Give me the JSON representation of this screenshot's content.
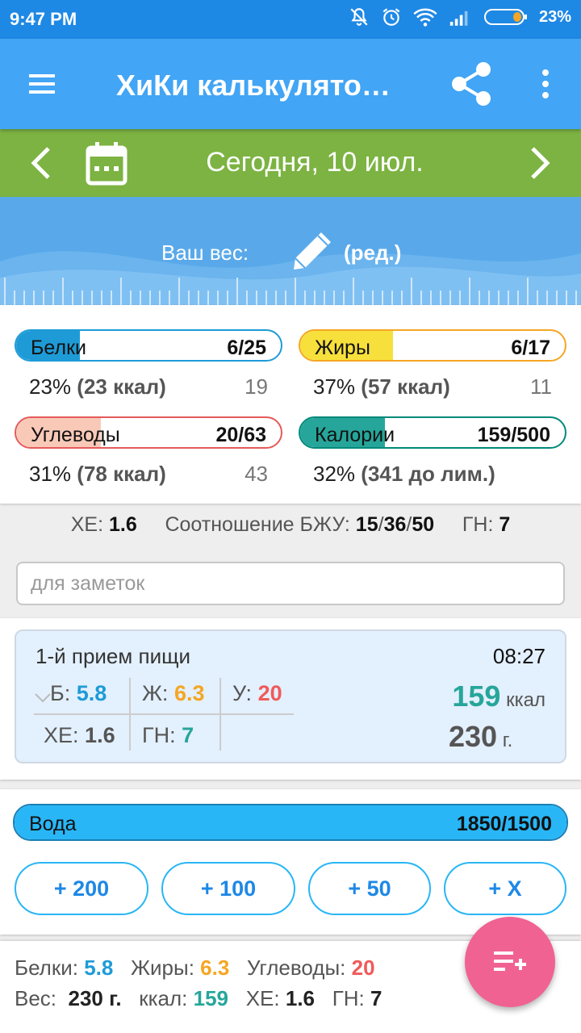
{
  "status_bar": {
    "time": "9:47 PM",
    "battery": "23%"
  },
  "app_bar": {
    "title": "ХиКи калькулято…",
    "menu_icon": "hamburger-icon",
    "share_icon": "share-icon",
    "more_icon": "more-vert-icon"
  },
  "date_bar": {
    "date": "Сегодня, 10 июл."
  },
  "weight": {
    "label": "Ваш вес:",
    "edit": "(ред.)"
  },
  "macros": {
    "protein": {
      "name": "Белки",
      "value": "6/25",
      "fraction": 0.24,
      "percent": "23%",
      "kcal": "(23 ккал)",
      "remaining": "19",
      "color": "#1e9bd7"
    },
    "fat": {
      "name": "Жиры",
      "value": "6/17",
      "fraction": 0.35,
      "percent": "37%",
      "kcal": "(57 ккал)",
      "remaining": "11",
      "color": "#f7e03c"
    },
    "carbs": {
      "name": "Углеводы",
      "value": "20/63",
      "fraction": 0.32,
      "percent": "31%",
      "kcal": "(78 ккал)",
      "remaining": "43",
      "color": "#f9c9b8"
    },
    "calories": {
      "name": "Калории",
      "value": "159/500",
      "fraction": 0.32,
      "percent": "32%",
      "kcal": "(341 до лим.)",
      "remaining": "",
      "color": "#26a69a"
    }
  },
  "ratios": {
    "xe_label": "ХЕ:",
    "xe": "1.6",
    "bju_label": "Соотношение БЖУ:",
    "b": "15",
    "sep": "/",
    "j": "36",
    "u": "50",
    "gn_label": "ГН:",
    "gn": "7"
  },
  "notes": {
    "placeholder": "для заметок",
    "value": ""
  },
  "meal": {
    "title": "1-й прием пищи",
    "time": "08:27",
    "b_label": "Б:",
    "b": "5.8",
    "j_label": "Ж:",
    "j": "6.3",
    "u_label": "У:",
    "u": "20",
    "xe_label": "ХЕ:",
    "xe": "1.6",
    "gn_label": "ГН:",
    "gn": "7",
    "kcal": "159",
    "kcal_unit": "ккал",
    "weight": "230",
    "weight_unit": "г."
  },
  "water": {
    "name": "Вода",
    "value": "1850/1500",
    "fraction": 1.0,
    "color": "#29b6f6",
    "buttons": [
      "+ 200",
      "+ 100",
      "+ 50",
      "+ X"
    ]
  },
  "totals": {
    "protein_label": "Белки:",
    "protein": "5.8",
    "fat_label": "Жиры:",
    "fat": "6.3",
    "carbs_label": "Углеводы:",
    "carbs": "20",
    "weight_label": "Вес:",
    "weight": "230 г.",
    "kcal_label": "ккал:",
    "kcal": "159",
    "xe_label": "ХЕ:",
    "xe": "1.6",
    "gn_label": "ГН:",
    "gn": "7"
  },
  "fab": {
    "icon": "add-to-list-icon"
  }
}
